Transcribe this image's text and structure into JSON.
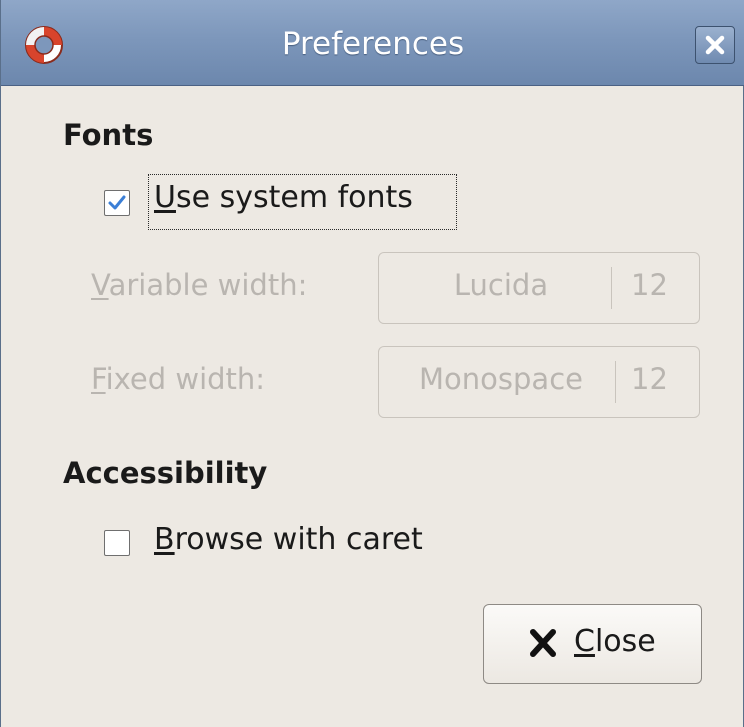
{
  "window": {
    "title": "Preferences",
    "app_icon": "lifebuoy-icon",
    "close_icon": "close-icon"
  },
  "fonts_section": {
    "title": "Fonts",
    "use_system_fonts": {
      "label_mnemonic": "U",
      "label_rest": "se system fonts",
      "checked": true
    },
    "variable_width": {
      "label_mnemonic": "V",
      "label_rest": "ariable width:",
      "font_name": "Lucida",
      "font_size": "12"
    },
    "fixed_width": {
      "label_mnemonic": "F",
      "label_rest": "ixed width:",
      "font_name": "Monospace",
      "font_size": "12"
    }
  },
  "accessibility_section": {
    "title": "Accessibility",
    "browse_with_caret": {
      "label_mnemonic": "B",
      "label_rest": "rowse with caret",
      "checked": false
    }
  },
  "close_button": {
    "icon": "x-icon",
    "label_mnemonic": "C",
    "label_rest": "lose"
  },
  "colors": {
    "titlebar": "#7d97bb",
    "background": "#ede9e3",
    "check_accent": "#3b7fd6",
    "disabled_text": "#b9b5b0"
  }
}
